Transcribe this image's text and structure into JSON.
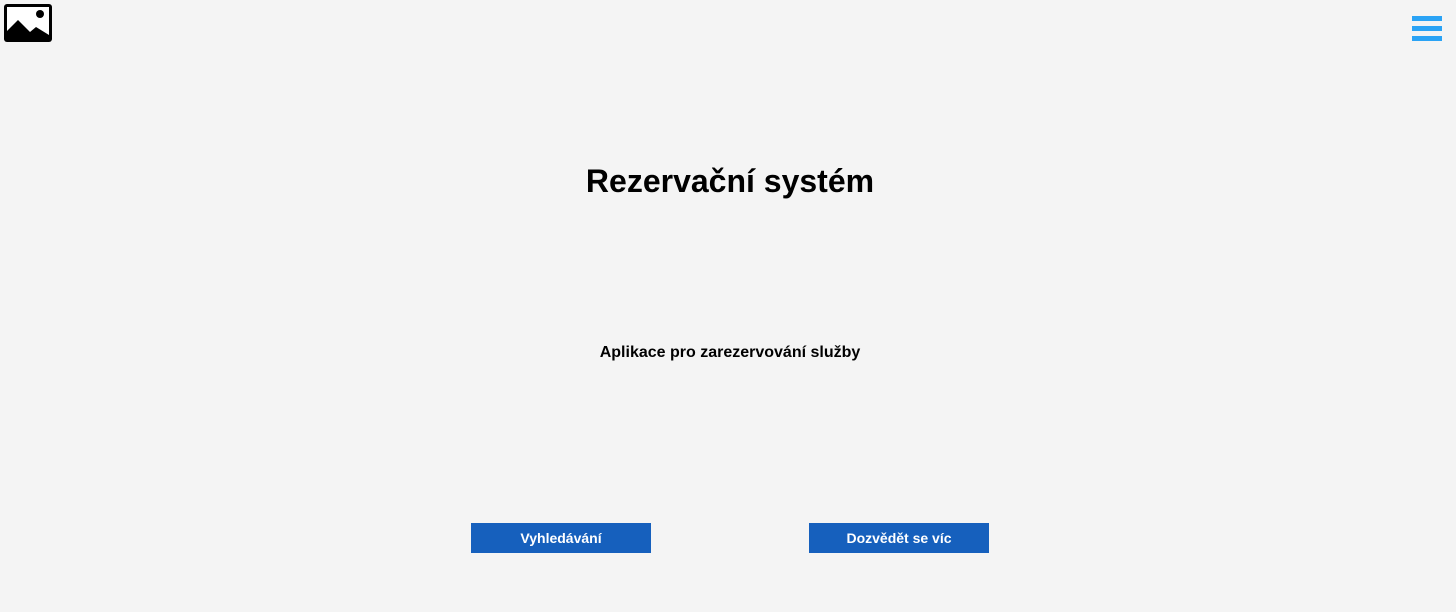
{
  "header": {
    "logo_icon": "image-placeholder-icon",
    "menu_icon": "hamburger-menu-icon",
    "menu_color": "#2aa3f5"
  },
  "hero": {
    "title": "Rezervační systém",
    "subtitle": "Aplikace pro zarezervování služby"
  },
  "actions": {
    "search_label": "Vyhledávání",
    "learn_more_label": "Dozvědět se víc",
    "button_color": "#1660bd"
  }
}
